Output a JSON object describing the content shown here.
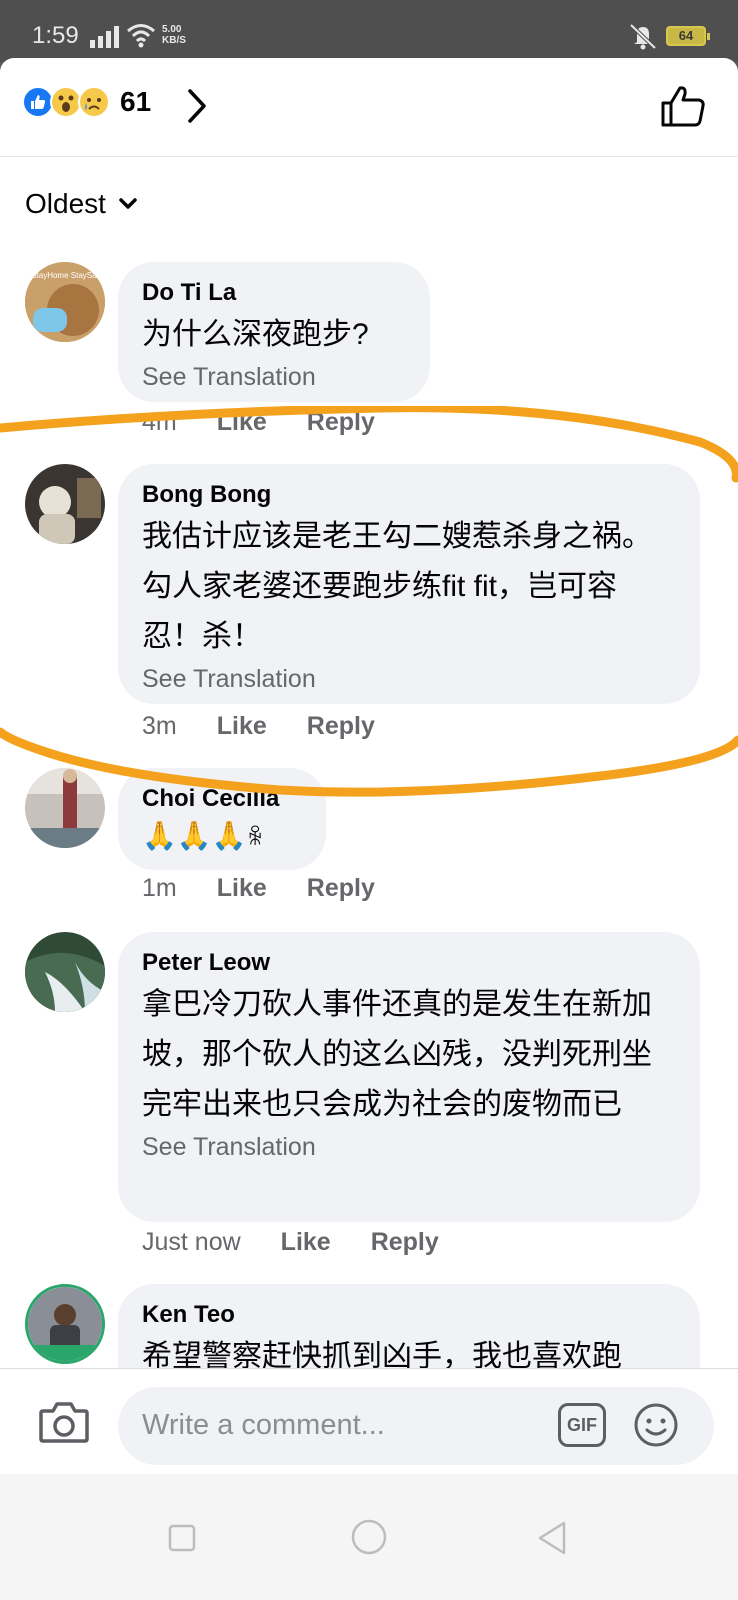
{
  "status_bar": {
    "time": "1:59",
    "net_speed_value": "5.00",
    "net_speed_unit": "KB/S",
    "battery": "64"
  },
  "reactions": {
    "icons": [
      "like-icon",
      "wow-icon",
      "sad-icon"
    ],
    "count": "61"
  },
  "sort": {
    "label": "Oldest"
  },
  "comments": [
    {
      "author": "Do Ti La",
      "avatar_text": "#StayHome StaySafe",
      "text": "为什么深夜跑步?",
      "see_translation": "See Translation",
      "time": "4m",
      "like": "Like",
      "reply": "Reply"
    },
    {
      "author": "Bong Bong",
      "text": "我估计应该是老王勾二嫂惹杀身之祸。勾人家老婆还要跑步练fit fit，岂可容忍！杀！",
      "see_translation": "See Translation",
      "time": "3m",
      "like": "Like",
      "reply": "Reply"
    },
    {
      "author": "Choi Cecilia",
      "text": "🙏🙏🙏",
      "time": "1m",
      "like": "Like",
      "reply": "Reply"
    },
    {
      "author": "Peter Leow",
      "text": "拿巴冷刀砍人事件还真的是发生在新加坡，那个砍人的这么凶残，没判死刑坐完牢出来也只会成为社会的废物而已",
      "see_translation": "See Translation",
      "time": "Just now",
      "like": "Like",
      "reply": "Reply"
    },
    {
      "author": "Ken Teo",
      "text": "希望警察赶快抓到凶手，我也喜欢跑"
    }
  ],
  "composer": {
    "placeholder": "Write a comment...",
    "gif_label": "GIF"
  },
  "colors": {
    "facebook_blue": "#1877f2",
    "bubble_gray": "#f0f2f5",
    "annotation_orange": "#f4a21d"
  }
}
